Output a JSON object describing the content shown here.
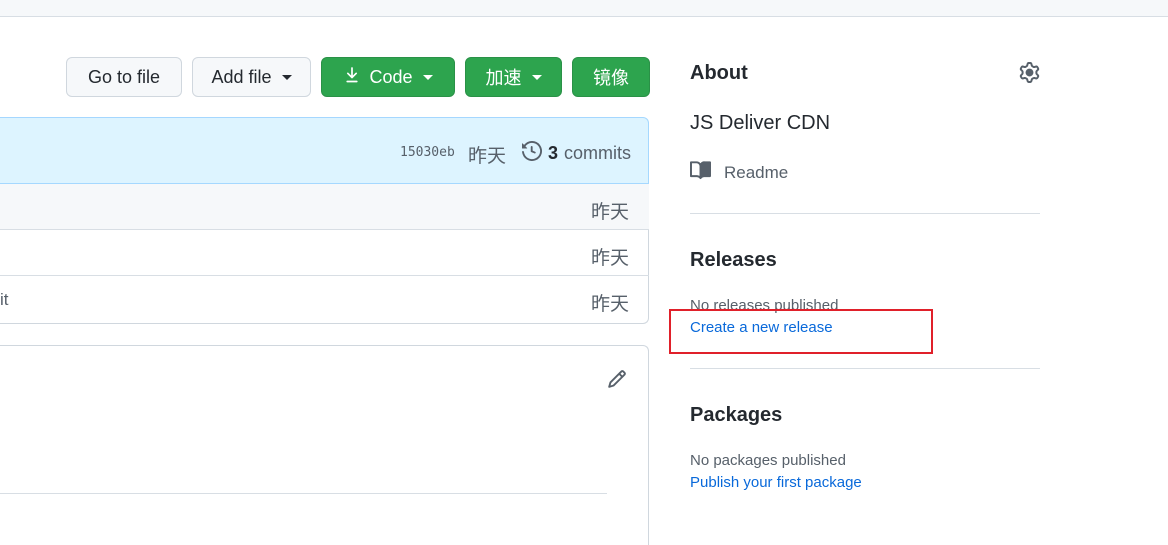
{
  "toolbar": {
    "go_to_file": "Go to file",
    "add_file": "Add file",
    "code": "Code",
    "speed_up": "加速",
    "mirror": "镜像"
  },
  "commit_bar": {
    "sha": "15030eb",
    "time": "昨天",
    "commit_count": "3",
    "commits_label": "commits"
  },
  "files": [
    {
      "name": "",
      "time": "昨天"
    },
    {
      "name": "",
      "time": "昨天"
    },
    {
      "name": "it",
      "time": "昨天"
    }
  ],
  "about": {
    "title": "About",
    "description": "JS Deliver CDN",
    "readme": "Readme"
  },
  "releases": {
    "title": "Releases",
    "empty": "No releases published",
    "create_link": "Create a new release"
  },
  "packages": {
    "title": "Packages",
    "empty": "No packages published",
    "publish_link": "Publish your first package"
  },
  "colors": {
    "green": "#2da44e",
    "link": "#0969da",
    "highlight": "#e0202a"
  }
}
